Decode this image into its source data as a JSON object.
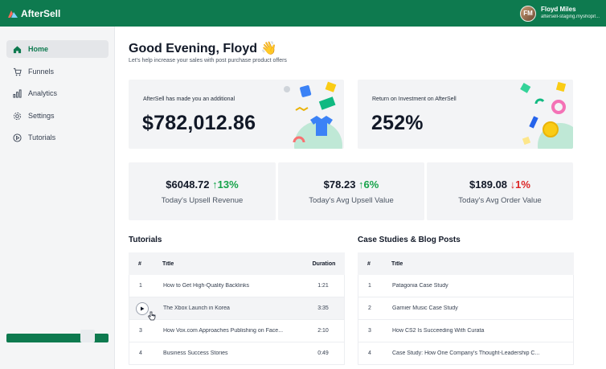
{
  "app": {
    "name": "AfterSell"
  },
  "user": {
    "name": "Floyd Miles",
    "store": "aftersell-staging.myshopif...",
    "initials": "FM"
  },
  "sidebar": {
    "items": [
      {
        "label": "Home",
        "icon": "home-icon"
      },
      {
        "label": "Funnels",
        "icon": "cart-icon"
      },
      {
        "label": "Analytics",
        "icon": "bar-chart-icon"
      },
      {
        "label": "Settings",
        "icon": "gear-icon"
      },
      {
        "label": "Tutorials",
        "icon": "play-circle-icon"
      }
    ]
  },
  "greeting": {
    "title": "Good Evening, Floyd 👋",
    "subtitle": "Let's help increase your sales with post purchase product offers"
  },
  "highlights": [
    {
      "label": "AfterSell has made you an additional",
      "value": "$782,012.86"
    },
    {
      "label": "Return on Investment on AfterSell",
      "value": "252%"
    }
  ],
  "stats": [
    {
      "value": "$6048.72",
      "change": "13%",
      "direction": "up",
      "label": "Today's Upsell Revenue"
    },
    {
      "value": "$78.23",
      "change": "6%",
      "direction": "up",
      "label": "Today's Avg Upsell Value"
    },
    {
      "value": "$189.08",
      "change": "1%",
      "direction": "down",
      "label": "Today's Avg Order Value"
    }
  ],
  "tutorials": {
    "title": "Tutorials",
    "headers": {
      "num": "#",
      "title": "Title",
      "duration": "Duration"
    },
    "rows": [
      {
        "num": "1",
        "title": " How to Get High-Quality Backlinks",
        "duration": "1:21"
      },
      {
        "num": "",
        "title": "The Xbox Launch in Korea",
        "duration": "3:35"
      },
      {
        "num": "3",
        "title": "How Vox.com Approaches Publishing on Face...",
        "duration": "2:10"
      },
      {
        "num": "4",
        "title": "Business Success Stories",
        "duration": "0:49"
      }
    ]
  },
  "case_studies": {
    "title": "Case Studies & Blog Posts",
    "headers": {
      "num": "#",
      "title": "Title"
    },
    "rows": [
      {
        "num": "1",
        "title": "Patagonia Case Study"
      },
      {
        "num": "2",
        "title": "Garnier Music Case Study"
      },
      {
        "num": "3",
        "title": "How CS2 Is Succeeding With Curata"
      },
      {
        "num": "4",
        "title": "Case Study: How One Company's Thought-Leadership C..."
      }
    ]
  },
  "colors": {
    "brand": "#0e7a4f",
    "up": "#16a34a",
    "down": "#dc2626",
    "card": "#f3f4f6"
  }
}
